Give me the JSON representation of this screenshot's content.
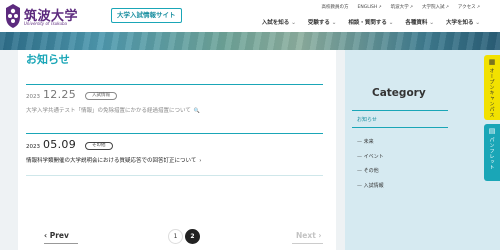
{
  "header": {
    "university_name": "筑波大学",
    "university_name_en": "University of Tsukuba",
    "site_badge": "大学入試情報サイト",
    "util_links": [
      "高校教員の方",
      "ENGLISH",
      "筑波大学",
      "大学院入試",
      "アクセス"
    ],
    "main_nav": [
      "入試を知る",
      "受験する",
      "相談・質問する",
      "各種資料",
      "大学を知る"
    ]
  },
  "main": {
    "title": "お知らせ",
    "news": [
      {
        "year": "2023",
        "date": "12.25",
        "tag": "入試情報",
        "text": "大学入学共通テスト「情報」の免除措置にかかる経過措置について"
      },
      {
        "year": "2023",
        "date": "05.09",
        "tag": "その他",
        "text": "情報科学類開催の大学説明会における質疑応答での回答訂正について"
      }
    ],
    "pager": {
      "prev": "Prev",
      "next": "Next",
      "pages": [
        "1",
        "2"
      ]
    }
  },
  "sidebar": {
    "title": "Category",
    "current": "お知らせ",
    "items": [
      "未来",
      "イベント",
      "その他",
      "入試情報"
    ]
  },
  "floating_tabs": {
    "open_campus": "オープンキャンパス",
    "pamphlet": "パンフレット"
  },
  "colors": {
    "accent": "#1aa6b7",
    "brand": "#5c2a7e",
    "tab_yellow": "#f2e100"
  }
}
